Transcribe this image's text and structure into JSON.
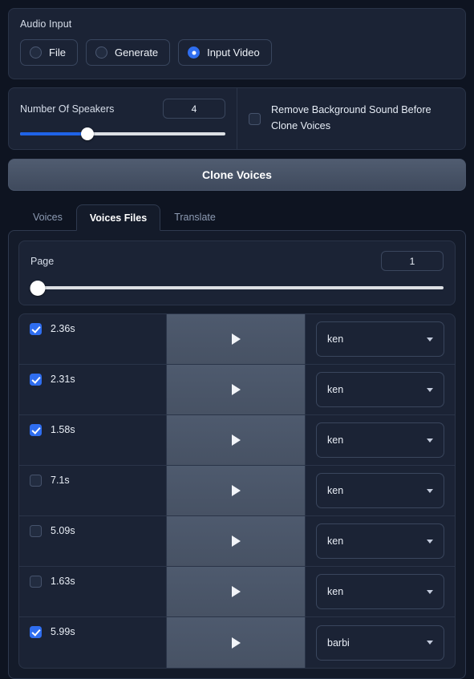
{
  "audio_input": {
    "label": "Audio Input",
    "options": [
      {
        "label": "File",
        "selected": false
      },
      {
        "label": "Generate",
        "selected": false
      },
      {
        "label": "Input Video",
        "selected": true
      }
    ]
  },
  "speakers": {
    "label": "Number Of Speakers",
    "value": "4",
    "slider_percent": 33
  },
  "remove_background": {
    "label": "Remove Background Sound Before Clone Voices",
    "checked": false
  },
  "clone_button": {
    "label": "Clone Voices"
  },
  "tabs": [
    {
      "label": "Voices",
      "active": false
    },
    {
      "label": "Voices Files",
      "active": true
    },
    {
      "label": "Translate",
      "active": false
    }
  ],
  "page": {
    "label": "Page",
    "value": "1",
    "slider_percent": 0
  },
  "voice_files": {
    "rows": [
      {
        "duration": "2.36s",
        "checked": true,
        "voice": "ken"
      },
      {
        "duration": "2.31s",
        "checked": true,
        "voice": "ken"
      },
      {
        "duration": "1.58s",
        "checked": true,
        "voice": "ken"
      },
      {
        "duration": "7.1s",
        "checked": false,
        "voice": "ken"
      },
      {
        "duration": "5.09s",
        "checked": false,
        "voice": "ken"
      },
      {
        "duration": "1.63s",
        "checked": false,
        "voice": "ken"
      },
      {
        "duration": "5.99s",
        "checked": true,
        "voice": "barbi"
      }
    ]
  },
  "colors": {
    "accent": "#2f6ef0",
    "slider_fill": "#1f63e8",
    "page_bg": "#0e1421",
    "panel_bg": "#1b2335",
    "play_cell": "#4e5a6e"
  },
  "icons": {
    "play": "play-icon",
    "caret": "chevron-down-icon"
  }
}
